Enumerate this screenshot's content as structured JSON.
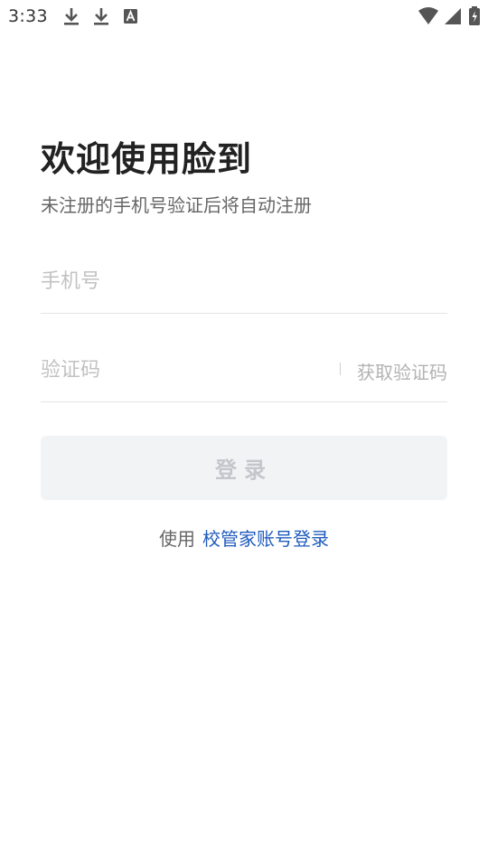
{
  "status_bar": {
    "time": "3:33",
    "left_icons": [
      "download-icon",
      "download-icon",
      "font-icon"
    ],
    "right_icons": [
      "wifi-icon",
      "cellular-signal-icon",
      "battery-charging-icon"
    ]
  },
  "main": {
    "title": "欢迎使用脸到",
    "subtitle": "未注册的手机号验证后将自动注册"
  },
  "form": {
    "phone_placeholder": "手机号",
    "code_placeholder": "验证码",
    "get_code_label": "获取验证码",
    "login_label": "登录"
  },
  "alt_login": {
    "prefix": "使用",
    "link_label": "校管家账号登录"
  },
  "colors": {
    "link": "#1f5bbd",
    "button_bg": "#f2f3f5",
    "button_text": "#c4c6cc",
    "title": "#222222"
  }
}
